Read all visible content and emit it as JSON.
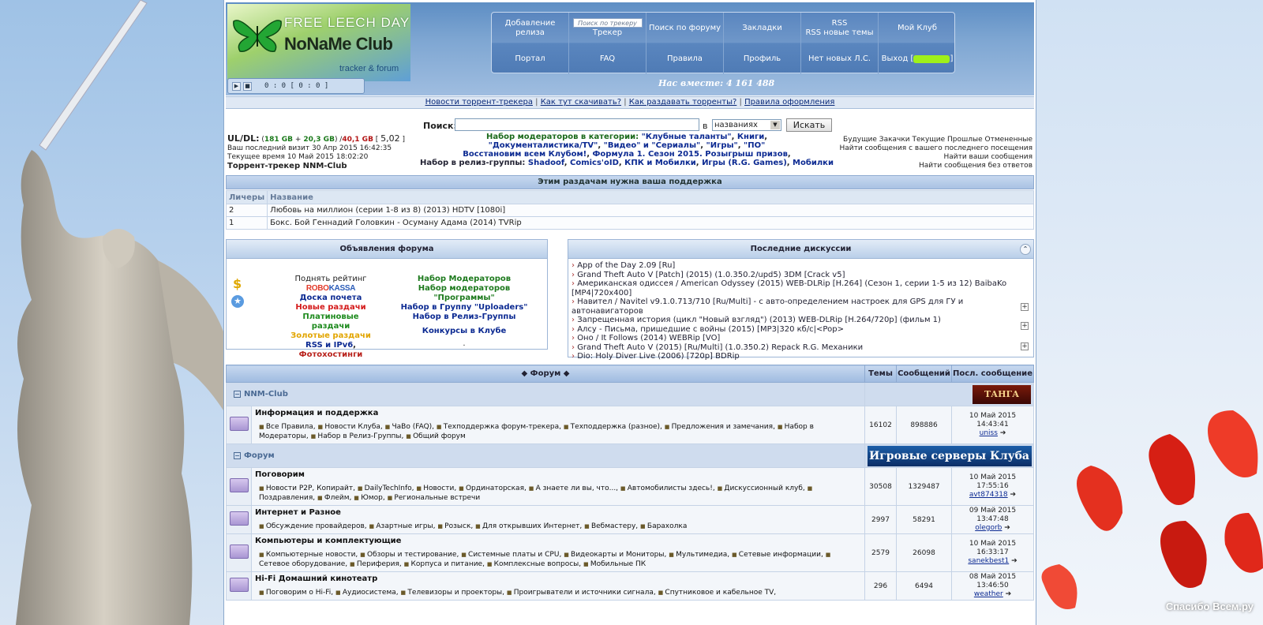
{
  "watermark": "Спасибо Всем.ру",
  "logo": {
    "top": "FREE LEECH DAY",
    "main": "NoNaMe Club",
    "sub": "tracker & forum"
  },
  "player": {
    "time": "0 : 0     [ 0 : 0 ]"
  },
  "nav": {
    "row1": [
      {
        "label": "Добавление релиза"
      },
      {
        "label": "Трекер",
        "search_placeholder": "Поиск по трекеру"
      },
      {
        "label": "Поиск по форуму"
      },
      {
        "label": "Закладки"
      },
      {
        "label": "RSS\nRSS новые темы"
      },
      {
        "label": "Мой Клуб"
      }
    ],
    "row2": [
      "Портал",
      "FAQ",
      "Правила",
      "Профиль",
      "Нет новых Л.С.",
      "Выход ["
    ],
    "logout_suffix": "]"
  },
  "together": "Нас вместе: 4 161 488",
  "linkbar": [
    "Новости торрент-трекера",
    "Как тут скачивать?",
    "Как раздавать торренты?",
    "Правила оформления"
  ],
  "search": {
    "label": "Поиск:",
    "in": "в",
    "select": "названиях",
    "button": "Искать"
  },
  "user_info": {
    "uldl_label": "UL/DL:",
    "ul": "181 GB",
    "plus": "+",
    "bonus": "20,3 GB",
    "dl": "40,1 GB",
    "ratio": "5,02",
    "last_visit": "Ваш последний визит 30 Апр 2015 16:42:35",
    "current_time": "Текущее время 10 Май 2015 18:02:20",
    "tracker": "Торрент-трекер NNM-Club"
  },
  "news": {
    "l1_text": "Набор модераторов в категории:",
    "l1_links": [
      "\"Клубные таланты\"",
      "Книги"
    ],
    "l2_links": [
      "\"Документалистика/TV\"",
      "\"Видео\" и \"Сериалы\"",
      "\"Игры\"",
      "\"ПО\""
    ],
    "l3_links": [
      "Восстановим всем Клубом!",
      "Формула 1. Сезон 2015. Розыгрыш призов"
    ],
    "l4_text": "Набор в релиз-группы:",
    "l4_links": [
      "Shadoof",
      "Comics'oID",
      "КПК и Мобилки",
      "Игры (R.G. Games)",
      "Мобилки"
    ]
  },
  "right_links": {
    "l1": "Будущие Закачки Текущие Прошлые Отмененные",
    "l2": "Найти сообщения с вашего последнего посещения",
    "l3": "Найти ваши сообщения",
    "l4": "Найти сообщения без ответов"
  },
  "support": {
    "title": "Этим раздачам нужна ваша поддержка",
    "col_leechers": "Личеры",
    "col_name": "Название",
    "rows": [
      {
        "leechers": "2",
        "name": "Любовь на миллион (серии 1-8 из 8) (2013) HDTV [1080i]"
      },
      {
        "leechers": "1",
        "name": "Бокс. Бой Геннадий Головкин - Осуману Адама (2014) TVRip"
      }
    ]
  },
  "announcements": {
    "title": "Объявления форума",
    "col1": {
      "raise": "Поднять рейтинг",
      "robo1": "ROBO",
      "robo2": "KASSA",
      "board": "Доска почета",
      "new": "Новые раздачи",
      "platinum": "Платиновые раздачи",
      "gold": "Золотые раздачи",
      "rss": "RSS и IPv6",
      "photo": "Фотохостинги"
    },
    "col2": {
      "mods": "Набор Модераторов",
      "progs": "Набор модераторов \"Программы\"",
      "uploaders": "Набор в Группу \"Uploaders\"",
      "relgroups": "Набор в Релиз-Группы",
      "contests": "Конкурсы в Клубе",
      "dot": "."
    }
  },
  "discussions": {
    "title": "Последние дискуссии",
    "items": [
      "App of the Day 2.09 [Ru]",
      "Grand Theft Auto V [Patch] (2015) (1.0.350.2/upd5) 3DM [Crack v5]",
      "Американская одиссея / American Odyssey (2015) WEB-DLRip [H.264] (Сезон 1, серии 1-5 из 12) BaibaKo [MP4|720x400]",
      "Навител / Navitel v9.1.0.713/710 [Ru/Multi] - с авто-определением настроек для GPS для ГУ и автонавигаторов",
      "Запрещенная история (цикл \"Новый взгляд\") (2013) WEB-DLRip [H.264/720p] (фильм 1)",
      "Алсу - Письма, пришедшие с войны (2015) [MP3|320 кб/с|<Pop>",
      "Оно / It Follows (2014) WEBRip [VO]",
      "Grand Theft Auto V (2015) [Ru/Multi] (1.0.350.2) Repack R.G. Механики",
      "Dio: Holy Diver Live (2006) [720p] BDRip"
    ]
  },
  "forum": {
    "head": {
      "title": "Форум",
      "topics": "Темы",
      "posts": "Сообщений",
      "last": "Посл. сообщение"
    },
    "cat1": "NNM-Club",
    "cat1_banner": "ТАНГА",
    "cat2": "Форум",
    "cat2_banner": "Игровые серверы Клуба",
    "rows": [
      {
        "title": "Информация и поддержка",
        "subs": [
          "Все Правила,",
          "Новости Клуба,",
          "ЧаВо (FAQ),",
          "Техподдержка форум-трекера,",
          "Техподдержка (разное),",
          "Предложения и замечания,",
          "Набор в Модераторы,",
          "Набор в Релиз-Группы,",
          "Общий форум"
        ],
        "topics": "16102",
        "posts": "898886",
        "last_date": "10 Май 2015 14:43:41",
        "last_user": "uniss"
      },
      {
        "title": "Поговорим",
        "subs": [
          "Новости P2P, Копирайт,",
          "DailyTechInfo,",
          "Новости,",
          "Ординаторская,",
          "А знаете ли вы, что...,",
          "Автомобилисты здесь!,",
          "Дискуссионный клуб,",
          "Поздравления,",
          "Флейм,",
          "Юмор,",
          "Региональные встречи"
        ],
        "topics": "30508",
        "posts": "1329487",
        "last_date": "10 Май 2015 17:55:16",
        "last_user": "avt874318"
      },
      {
        "title": "Интернет и Разное",
        "subs": [
          "Обсуждение провайдеров,",
          "Азартные игры,",
          "Розыск,",
          "Для открывших Интернет,",
          "Вебмастеру,",
          "Барахолка"
        ],
        "topics": "2997",
        "posts": "58291",
        "last_date": "09 Май 2015 13:47:48",
        "last_user": "olegorb"
      },
      {
        "title": "Компьютеры и комплектующие",
        "subs": [
          "Компьютерные новости,",
          "Обзоры и тестирование,",
          "Системные платы и CPU,",
          "Видеокарты и Мониторы,",
          "Мультимедиа,",
          "Сетевые информации,",
          "Сетевое оборудование,",
          "Периферия,",
          "Корпуса и питание,",
          "Комплексные вопросы,",
          "Мобильные ПК"
        ],
        "topics": "2579",
        "posts": "26098",
        "last_date": "10 Май 2015 16:33:17",
        "last_user": "sanekbest1"
      },
      {
        "title": "Hi-Fi Домашний кинотеатр",
        "subs": [
          "Поговорим о Hi-Fi,",
          "Аудиосистема,",
          "Телевизоры и проекторы,",
          "Проигрыватели и источники сигнала,",
          "Спутниковое и кабельное TV,"
        ],
        "topics": "296",
        "posts": "6494",
        "last_date": "08 Май 2015 13:46:50",
        "last_user": "weather"
      }
    ]
  }
}
